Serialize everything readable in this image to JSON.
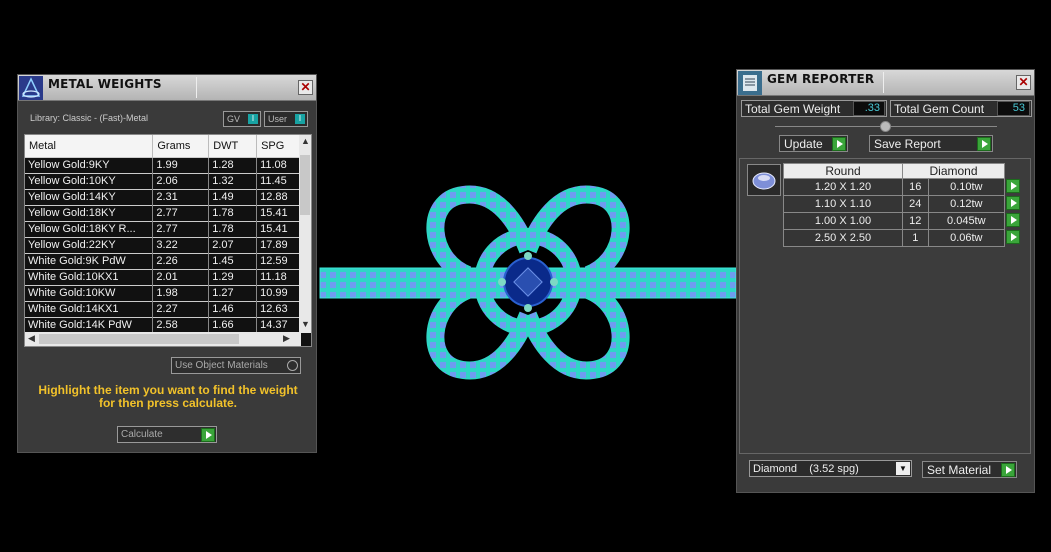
{
  "metal_panel": {
    "title": "METAL WEIGHTS",
    "library": "Library: Classic - (Fast)-Metal",
    "toggle_gv": "GV",
    "toggle_user": "User",
    "columns": [
      "Metal",
      "Grams",
      "DWT",
      "SPG"
    ],
    "rows": [
      [
        "Yellow Gold:9KY",
        "1.99",
        "1.28",
        "11.08"
      ],
      [
        "Yellow Gold:10KY",
        "2.06",
        "1.32",
        "11.45"
      ],
      [
        "Yellow Gold:14KY",
        "2.31",
        "1.49",
        "12.88"
      ],
      [
        "Yellow Gold:18KY",
        "2.77",
        "1.78",
        "15.41"
      ],
      [
        "Yellow Gold:18KY R...",
        "2.77",
        "1.78",
        "15.41"
      ],
      [
        "Yellow Gold:22KY",
        "3.22",
        "2.07",
        "17.89"
      ],
      [
        "White Gold:9K PdW",
        "2.26",
        "1.45",
        "12.59"
      ],
      [
        "White Gold:10KX1",
        "2.01",
        "1.29",
        "11.18"
      ],
      [
        "White Gold:10KW",
        "1.98",
        "1.27",
        "10.99"
      ],
      [
        "White Gold:14KX1",
        "2.27",
        "1.46",
        "12.63"
      ],
      [
        "White Gold:14K PdW",
        "2.58",
        "1.66",
        "14.37"
      ]
    ],
    "use_object_materials": "Use Object Materials",
    "hint": "Highlight the item you want to find the weight for then press calculate.",
    "calculate": "Calculate"
  },
  "gem_panel": {
    "title": "GEM REPORTER",
    "total_weight_label": "Total Gem Weight",
    "total_weight_value": ".33",
    "total_count_label": "Total Gem Count",
    "total_count_value": "53",
    "update": "Update",
    "save_report": "Save Report",
    "table_header": [
      "Round",
      "Diamond"
    ],
    "gems": [
      [
        "1.20 X 1.20",
        "16",
        "0.10tw"
      ],
      [
        "1.10 X 1.10",
        "24",
        "0.12tw"
      ],
      [
        "1.00 X 1.00",
        "12",
        "0.045tw"
      ],
      [
        "2.50 X 2.50",
        "1",
        "0.06tw"
      ]
    ],
    "material_select": "Diamond    (3.52 spg)",
    "set_material": "Set Material"
  },
  "colors": {
    "ring": "#37e0d0",
    "gem": "#0a2a8a",
    "hint": "#f2c22a",
    "value": "#48c7d4"
  }
}
